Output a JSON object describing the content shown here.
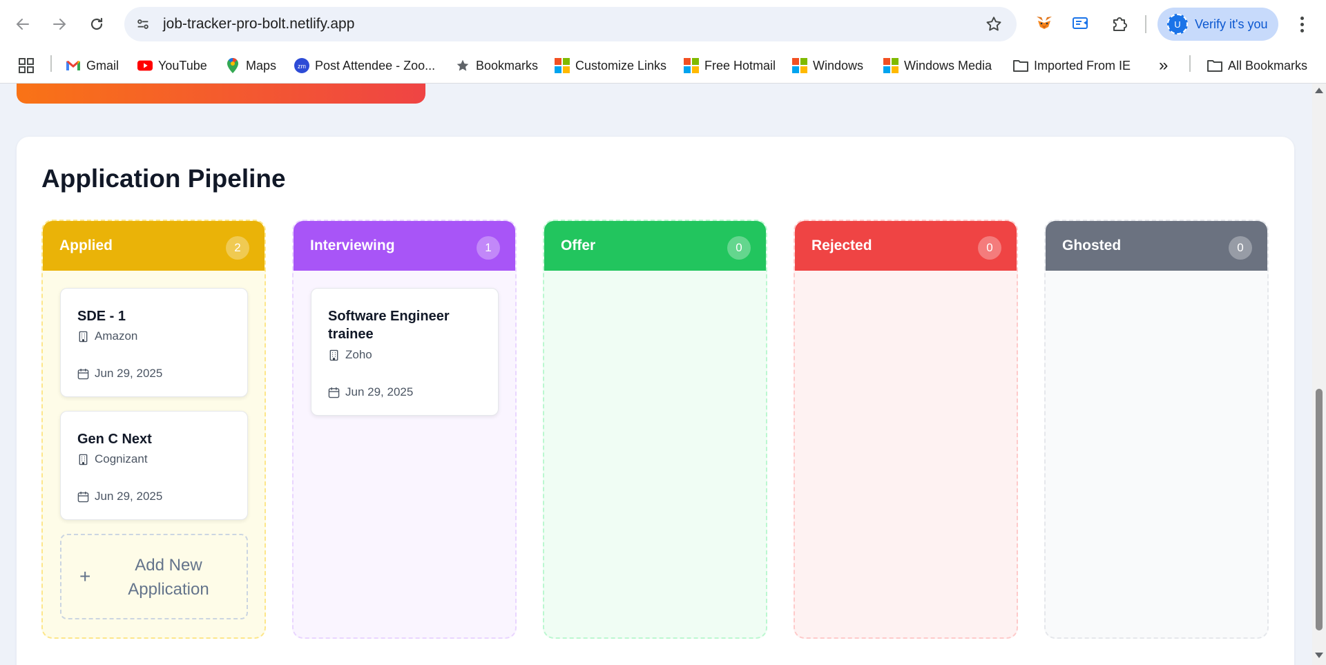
{
  "browser": {
    "url": "job-tracker-pro-bolt.netlify.app",
    "verify_label": "Verify it's you",
    "avatar_letter": "U",
    "bookmarks": [
      {
        "label": "Gmail",
        "icon": "gmail-icon"
      },
      {
        "label": "YouTube",
        "icon": "youtube-icon"
      },
      {
        "label": "Maps",
        "icon": "maps-icon"
      },
      {
        "label": "Post Attendee - Zoo...",
        "icon": "zoom-icon"
      },
      {
        "label": "Bookmarks",
        "icon": "star-icon"
      },
      {
        "label": "Customize Links",
        "icon": "microsoft-icon"
      },
      {
        "label": "Free Hotmail",
        "icon": "microsoft-icon"
      },
      {
        "label": "Windows",
        "icon": "microsoft-icon"
      },
      {
        "label": "Windows Media",
        "icon": "microsoft-icon"
      },
      {
        "label": "Imported From IE",
        "icon": "folder-icon"
      }
    ],
    "all_bookmarks_label": "All Bookmarks",
    "overflow_label": "»"
  },
  "pipeline": {
    "title": "Application Pipeline",
    "columns": [
      {
        "name": "Applied",
        "count": "2",
        "color": "#eab308",
        "border": "#fde68a",
        "bg": "#fefce8",
        "cards": [
          {
            "title": "SDE - 1",
            "company": "Amazon",
            "date": "Jun 29, 2025"
          },
          {
            "title": "Gen C Next",
            "company": "Cognizant",
            "date": "Jun 29, 2025"
          }
        ],
        "add_label": "Add New Application"
      },
      {
        "name": "Interviewing",
        "count": "1",
        "color": "#a855f7",
        "border": "#e9d5ff",
        "bg": "#faf5ff",
        "cards": [
          {
            "title": "Software Engineer trainee",
            "company": "Zoho",
            "date": "Jun 29, 2025"
          }
        ]
      },
      {
        "name": "Offer",
        "count": "0",
        "color": "#22c55e",
        "border": "#bbf7d0",
        "bg": "#f0fdf4",
        "cards": []
      },
      {
        "name": "Rejected",
        "count": "0",
        "color": "#ef4444",
        "border": "#fecaca",
        "bg": "#fef2f2",
        "cards": []
      },
      {
        "name": "Ghosted",
        "count": "0",
        "color": "#6b7280",
        "border": "#e5e7eb",
        "bg": "#f9fafb",
        "cards": []
      }
    ]
  }
}
